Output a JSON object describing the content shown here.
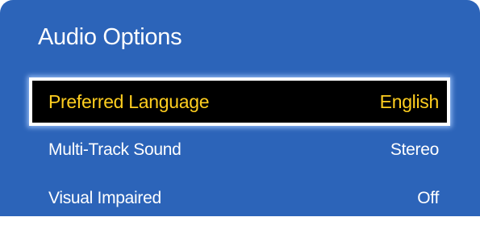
{
  "menu": {
    "title": "Audio Options",
    "items": [
      {
        "label": "Preferred Language",
        "value": "English",
        "selected": true
      },
      {
        "label": "Multi-Track Sound",
        "value": "Stereo",
        "selected": false
      },
      {
        "label": "Visual Impaired",
        "value": "Off",
        "selected": false
      }
    ]
  },
  "colors": {
    "panel_background": "#2c64b9",
    "selected_background": "#000000",
    "selected_text": "#ffce1f",
    "text": "#ffffff"
  }
}
